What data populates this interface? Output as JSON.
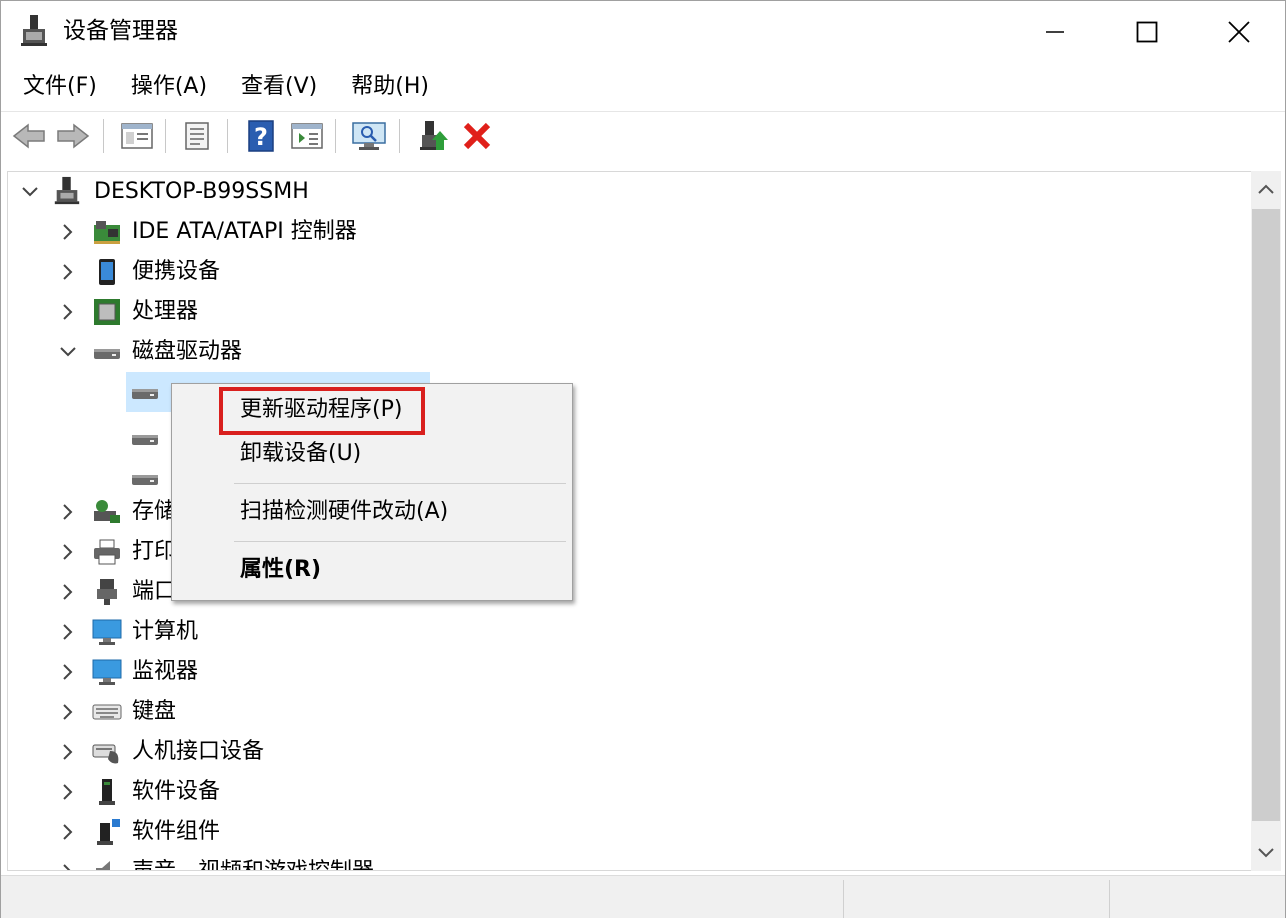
{
  "window": {
    "title": "设备管理器"
  },
  "menubar": [
    {
      "label": "文件(F)"
    },
    {
      "label": "操作(A)"
    },
    {
      "label": "查看(V)"
    },
    {
      "label": "帮助(H)"
    }
  ],
  "toolbar": {
    "buttons": [
      "back-icon",
      "forward-icon",
      "properties-window-icon",
      "document-icon",
      "help-icon",
      "run-window-icon",
      "monitor-scan-icon",
      "update-driver-icon",
      "uninstall-icon"
    ]
  },
  "tree": {
    "root": {
      "label": "DESKTOP-B99SSMH",
      "expanded": true
    },
    "items": [
      {
        "label": "IDE ATA/ATAPI 控制器",
        "icon": "ide-controller-icon",
        "expanded": false
      },
      {
        "label": "便携设备",
        "icon": "portable-device-icon",
        "expanded": false
      },
      {
        "label": "处理器",
        "icon": "processor-icon",
        "expanded": false
      },
      {
        "label": "磁盘驱动器",
        "icon": "disk-drive-icon",
        "expanded": true
      },
      {
        "label": "存储",
        "icon": "storage-icon",
        "expanded": false
      },
      {
        "label": "打印",
        "icon": "printer-icon",
        "expanded": false
      },
      {
        "label": "端口",
        "icon": "port-icon",
        "expanded": false
      },
      {
        "label": "计算机",
        "icon": "computer-icon",
        "expanded": false
      },
      {
        "label": "监视器",
        "icon": "monitor-icon",
        "expanded": false
      },
      {
        "label": "键盘",
        "icon": "keyboard-icon",
        "expanded": false
      },
      {
        "label": "人机接口设备",
        "icon": "hid-icon",
        "expanded": false
      },
      {
        "label": "软件设备",
        "icon": "software-device-icon",
        "expanded": false
      },
      {
        "label": "软件组件",
        "icon": "software-component-icon",
        "expanded": false
      },
      {
        "label": "声音、视频和游戏控制器",
        "icon": "sound-icon",
        "expanded": false
      }
    ]
  },
  "context_menu": {
    "items": [
      {
        "label": "更新驱动程序(P)",
        "highlighted": true
      },
      {
        "label": "卸载设备(U)"
      },
      {
        "label": "扫描检测硬件改动(A)"
      },
      {
        "label": "属性(R)",
        "bold": true
      }
    ]
  },
  "colors": {
    "highlight_border": "#d9201e",
    "selection": "#cce8ff",
    "uninstall_red": "#e0201a",
    "help_blue": "#2a5db0"
  }
}
